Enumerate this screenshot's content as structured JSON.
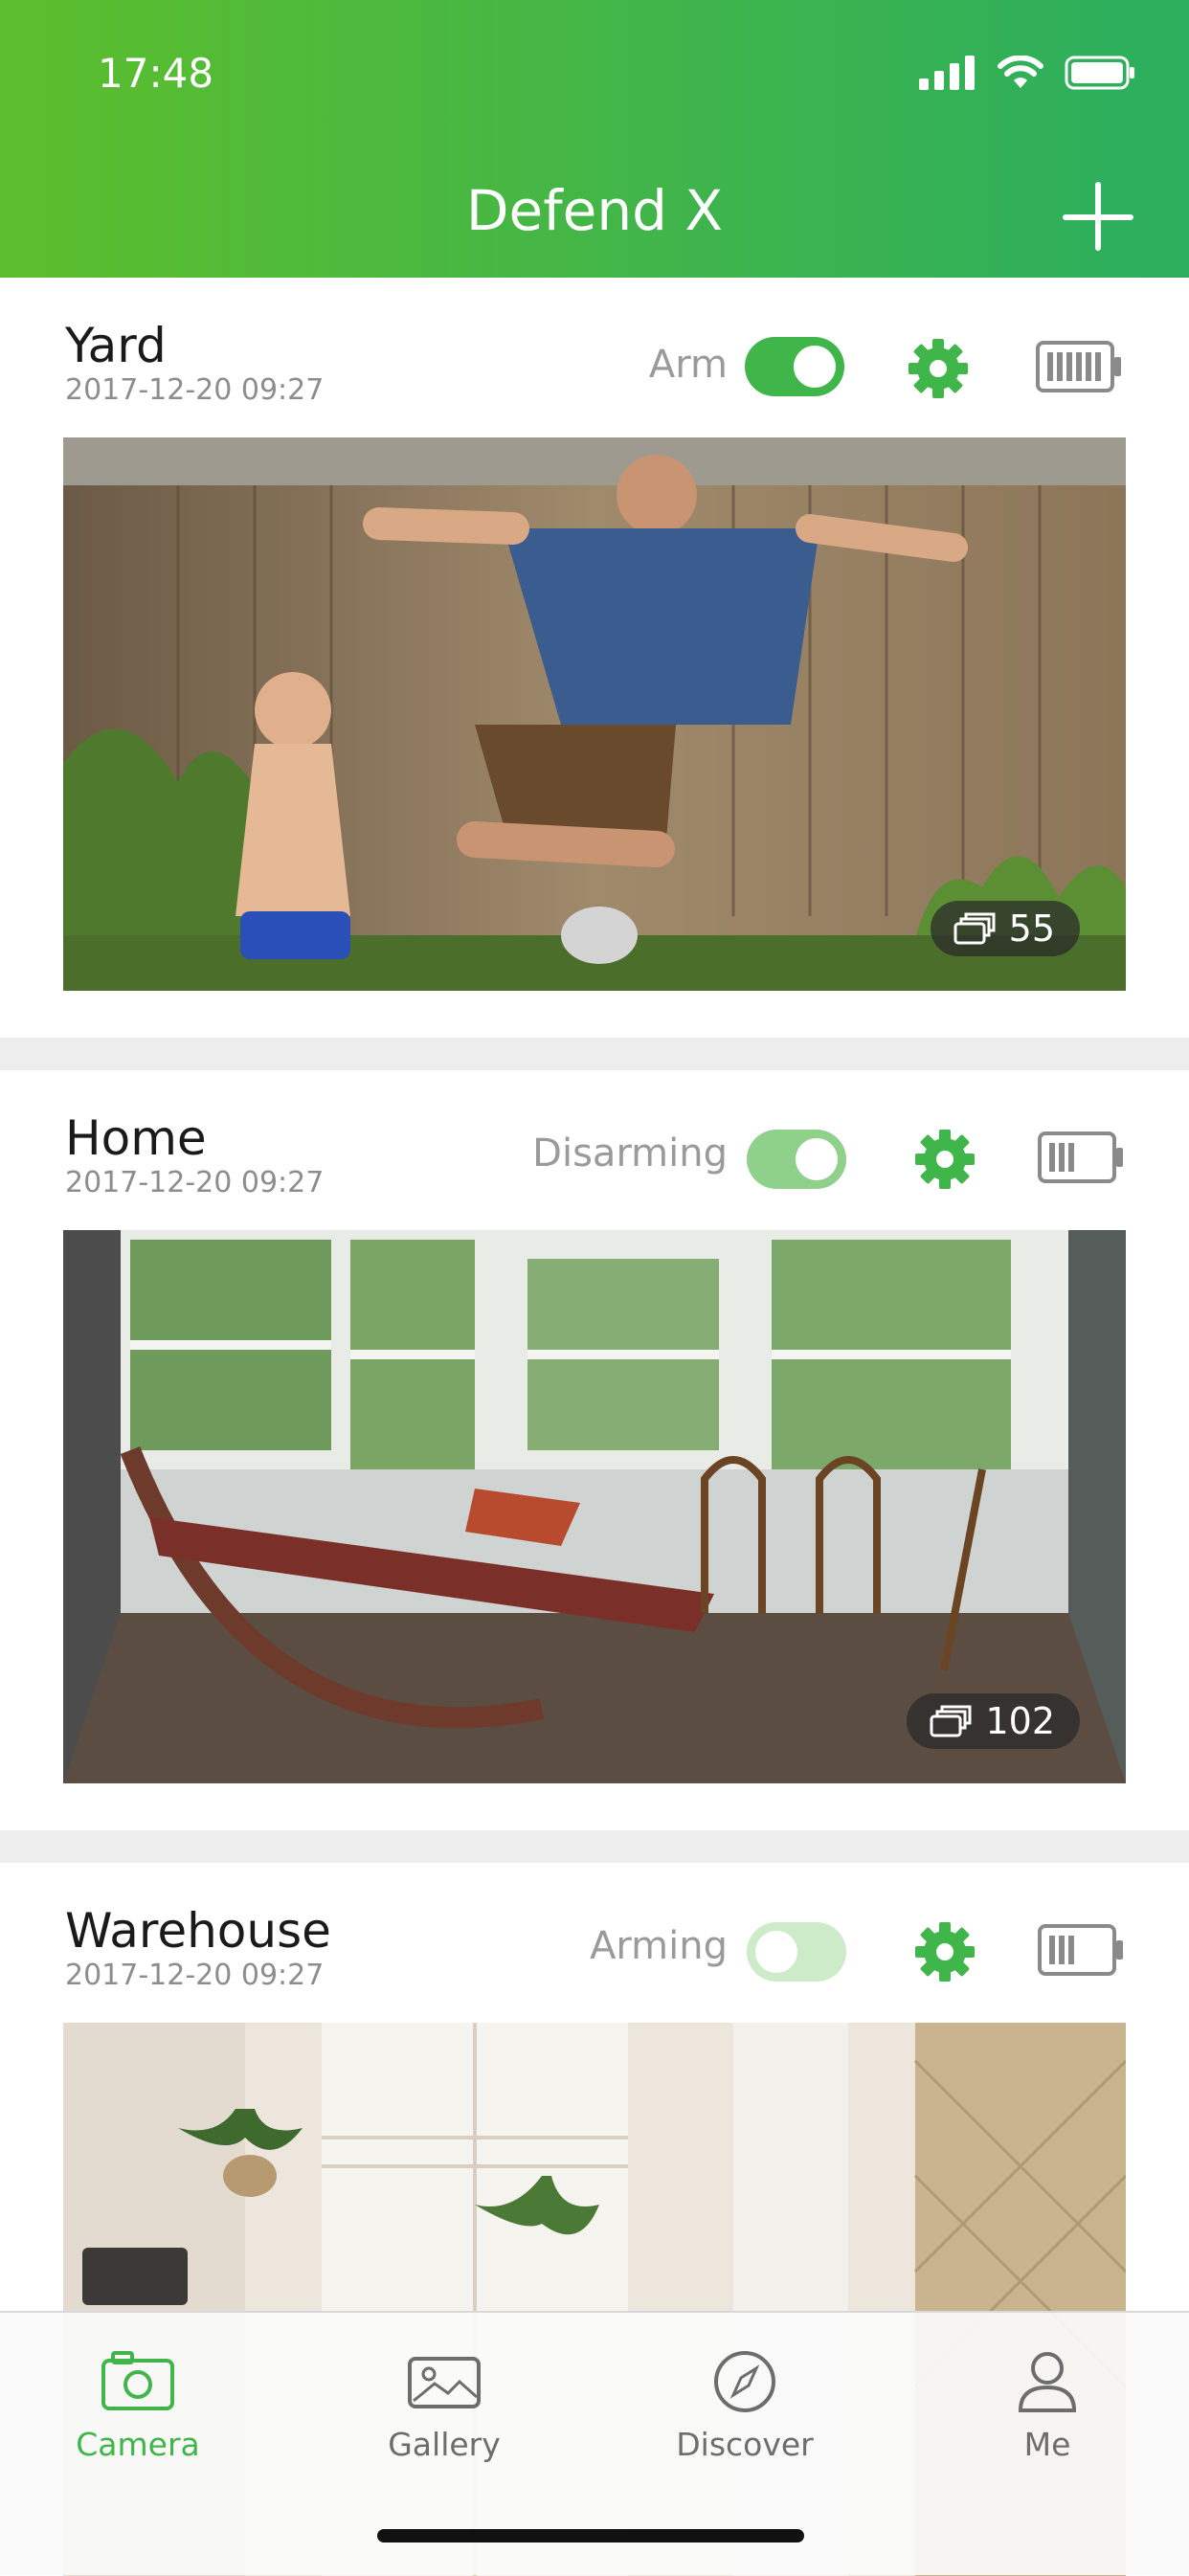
{
  "status_bar": {
    "time": "17:48"
  },
  "header": {
    "title": "Defend X",
    "add_icon": "plus-icon"
  },
  "colors": {
    "accent": "#3fb54a",
    "header_start": "#5cbe2c",
    "header_end": "#2bae5e"
  },
  "cameras": [
    {
      "name": "Yard",
      "date": "2017-12-20 09:27",
      "status": "Arm",
      "toggle_on": true,
      "battery_level": "full",
      "event_count": "55",
      "scene": "two boys jumping in a backyard by a wooden fence"
    },
    {
      "name": "Home",
      "date": "2017-12-20 09:27",
      "status": "Disarming",
      "toggle_on": true,
      "battery_level": "medium",
      "event_count": "102",
      "scene": "sunroom with a wooden hammock and chairs"
    },
    {
      "name": "Warehouse",
      "date": "2017-12-20 09:27",
      "status": "Arming",
      "toggle_on": false,
      "battery_level": "medium",
      "event_count": "",
      "scene": "bright living room with plants and a speaker"
    }
  ],
  "tabs": [
    {
      "label": "Camera",
      "icon": "camera-icon",
      "active": true
    },
    {
      "label": "Gallery",
      "icon": "gallery-icon",
      "active": false
    },
    {
      "label": "Discover",
      "icon": "compass-icon",
      "active": false
    },
    {
      "label": "Me",
      "icon": "person-icon",
      "active": false
    }
  ]
}
